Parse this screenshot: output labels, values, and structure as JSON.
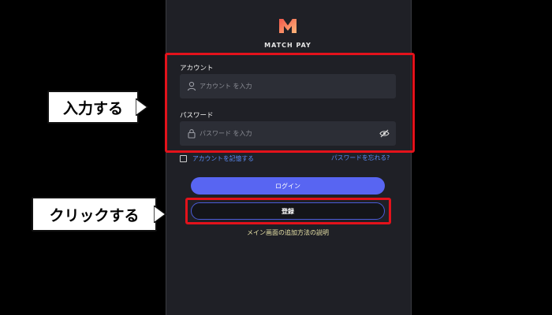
{
  "app": {
    "brand": "MATCH PAY"
  },
  "form": {
    "account_label": "アカウント",
    "account_placeholder": "アカウント を入力",
    "password_label": "パスワード",
    "password_placeholder": "パスワード を入力",
    "remember_label": "アカウントを記憶する",
    "forgot_label": "パスワードを忘れる?",
    "login_label": "ログイン",
    "register_label": "登録",
    "help_link": "メイン画面の追加方法の説明"
  },
  "annotations": {
    "input_callout": "入力する",
    "click_callout": "クリックする"
  },
  "colors": {
    "highlight": "#e3121b",
    "accent": "#5865f2",
    "link": "#5b8df6",
    "logo_gradient": [
      "#f0574a",
      "#ffb67a"
    ]
  },
  "icons": [
    "matchpay-logo",
    "user-icon",
    "lock-icon",
    "eye-off-icon",
    "checkbox"
  ]
}
